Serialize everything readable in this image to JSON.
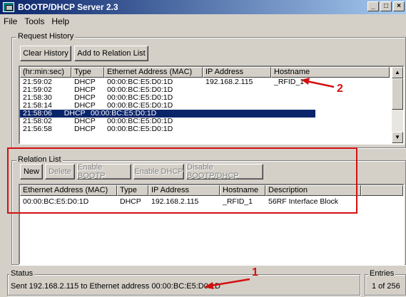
{
  "window": {
    "title": "BOOTP/DHCP Server 2.3"
  },
  "menu": [
    "File",
    "Tools",
    "Help"
  ],
  "request_history": {
    "label": "Request History",
    "buttons": {
      "clear": "Clear History",
      "add": "Add to Relation List"
    },
    "columns": [
      "(hr:min:sec)",
      "Type",
      "Ethernet Address (MAC)",
      "IP Address",
      "Hostname"
    ],
    "rows": [
      [
        "21:59:02",
        "DHCP",
        "00:00:BC:E5:D0:1D",
        "192.168.2.115",
        "_RFID_1"
      ],
      [
        "21:59:02",
        "DHCP",
        "00:00:BC:E5:D0:1D",
        "",
        ""
      ],
      [
        "21:58:30",
        "DHCP",
        "00:00:BC:E5:D0:1D",
        "",
        ""
      ],
      [
        "21:58:14",
        "DHCP",
        "00:00:BC:E5:D0:1D",
        "",
        ""
      ],
      [
        "21:58:06",
        "DHCP",
        "00:00:BC:E5:D0:1D",
        "",
        ""
      ],
      [
        "21:58:02",
        "DHCP",
        "00:00:BC:E5:D0:1D",
        "",
        ""
      ],
      [
        "21:56:58",
        "DHCP",
        "00:00:BC:E5:D0:1D",
        "",
        ""
      ]
    ],
    "selected_row": 4
  },
  "relation_list": {
    "label": "Relation List",
    "buttons": {
      "new": "New",
      "delete": "Delete",
      "enable_bootp": "Enable BOOTP",
      "enable_dhcp": "Enable DHCP",
      "disable_bootp_dhcp": "Disable BOOTP/DHCP"
    },
    "columns": [
      "Ethernet Address (MAC)",
      "Type",
      "IP Address",
      "Hostname",
      "Description"
    ],
    "rows": [
      [
        "00:00:BC:E5:D0:1D",
        "DHCP",
        "192.168.2.115",
        "_RFID_1",
        "56RF Interface Block"
      ]
    ]
  },
  "status": {
    "label": "Status",
    "text": "Sent 192.168.2.115 to Ethernet address 00:00:BC:E5:D0:1D"
  },
  "entries": {
    "label": "Entries",
    "value": "1 of 256"
  },
  "callouts": {
    "one": "1",
    "two": "2"
  },
  "colors": {
    "annotation": "#d41010",
    "selection": "#0a246a",
    "titlebar": "#0a246a"
  }
}
